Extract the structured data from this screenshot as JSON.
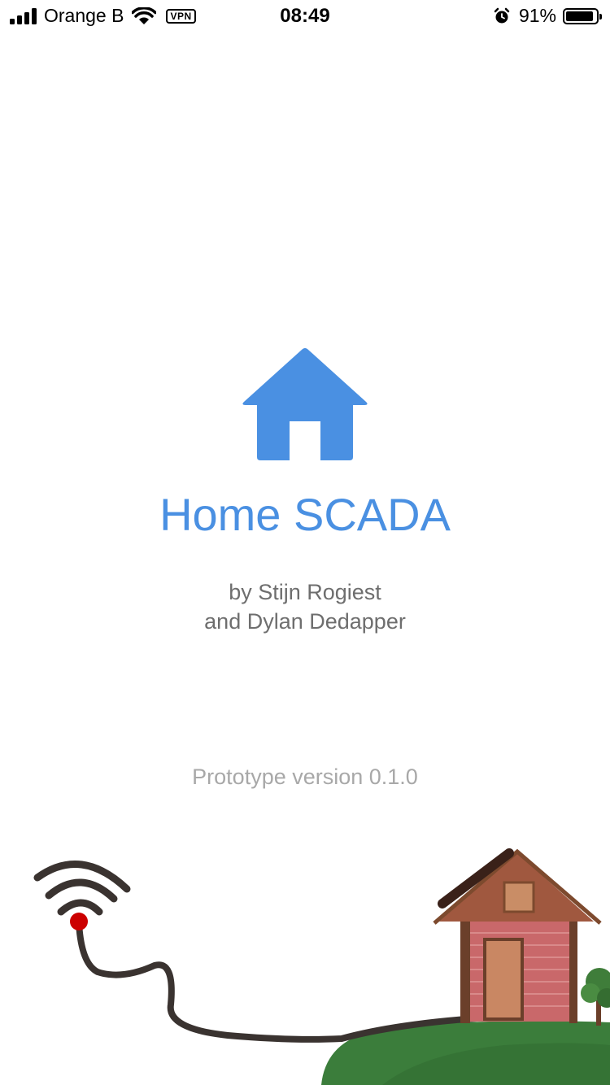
{
  "status_bar": {
    "carrier": "Orange B",
    "vpn": "VPN",
    "time": "08:49",
    "battery_percent": "91%",
    "battery_level": 0.91,
    "icons": [
      "signal-bars-icon",
      "wifi-icon",
      "vpn-icon",
      "alarm-icon",
      "battery-icon"
    ]
  },
  "splash": {
    "logo_icon": "house-icon",
    "title": "Home SCADA",
    "authors_line1": "by Stijn Rogiest",
    "authors_line2": "and Dylan Dedapper",
    "version": "Prototype version 0.1.0"
  },
  "colors": {
    "accent": "#4a90e2",
    "secondary_text": "#6e6e6e",
    "muted_text": "#a8a8a8",
    "grass": "#3b7d3b",
    "brick": "#c9686a",
    "cable": "#3a3330",
    "led": "#cc0000"
  }
}
